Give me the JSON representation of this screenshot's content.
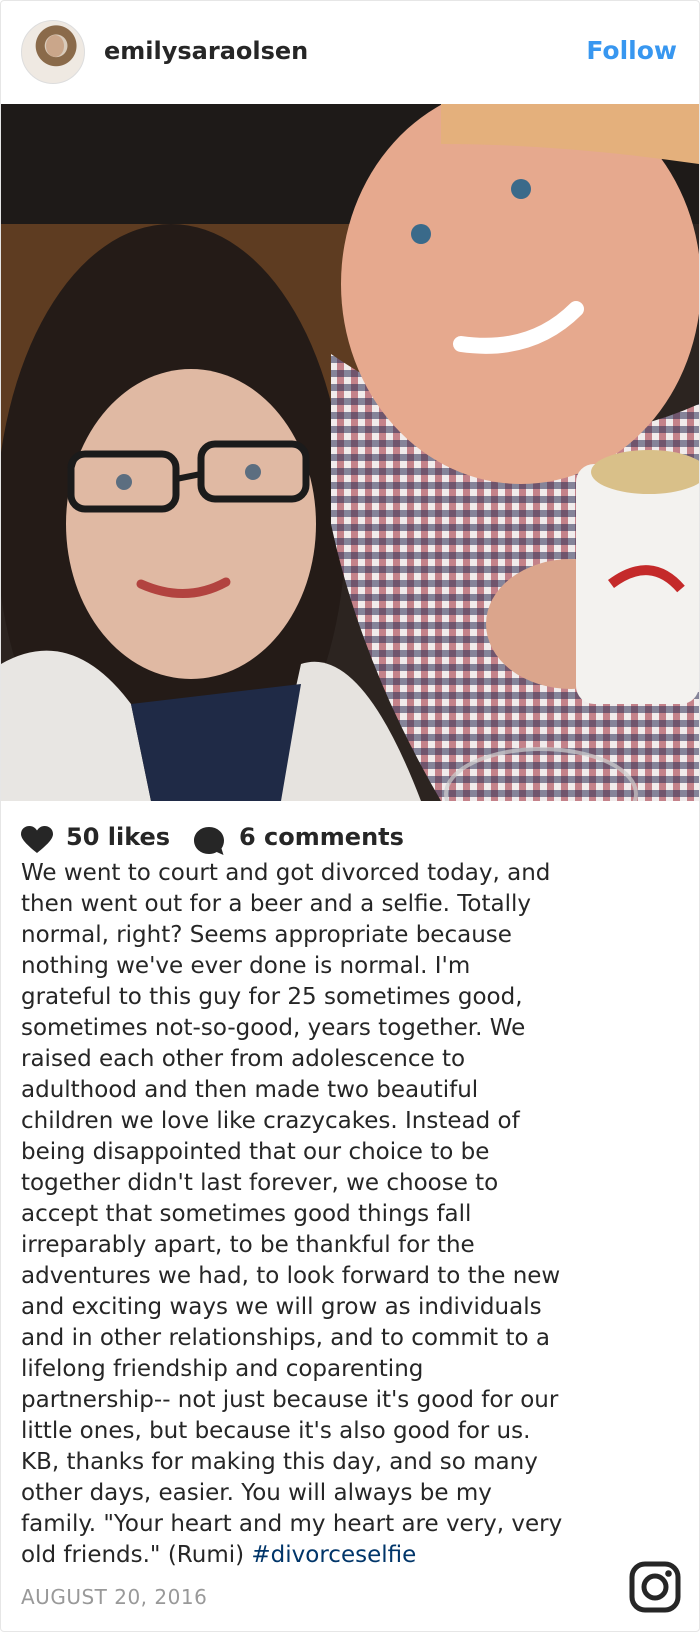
{
  "post": {
    "username": "emilysaraolsen",
    "follow_label": "Follow",
    "likes": "50 likes",
    "comments": "6 comments",
    "caption_lines": [
      "We went to court and got divorced today, and",
      "then went out for a beer and a selfie. Totally",
      "normal, right? Seems appropriate because",
      "nothing we've ever done is normal. I'm",
      "grateful to this guy for 25 sometimes good,",
      "sometimes not-so-good, years together. We",
      "raised each other from adolescence to",
      "adulthood and then made two beautiful",
      "children we love like crazycakes. Instead of",
      "being disappointed that our choice to be",
      "together didn't last forever, we choose to",
      "accept that sometimes good things fall",
      "irreparably apart, to be thankful for the",
      "adventures we had, to look forward to the new",
      "and exciting ways we will grow as individuals",
      "and in other relationships, and to commit to a",
      "lifelong friendship and coparenting",
      "partnership-- not just because it's good for our",
      "little ones, but because it's also good for us.",
      "KB, thanks for making this day, and so many",
      "other days, easier. You will always be my",
      "family. \"Your heart and my heart are very, very"
    ],
    "caption_last_line": "old friends.\" (Rumi) ",
    "hashtag": "#divorceselfie",
    "date": "AUGUST 20, 2016"
  },
  "icons": {
    "likes": "heart-icon",
    "comments": "comment-bubble-icon",
    "brand": "instagram-icon"
  },
  "colors": {
    "follow": "#3897f0",
    "hashtag": "#003569",
    "date": "#999999"
  }
}
